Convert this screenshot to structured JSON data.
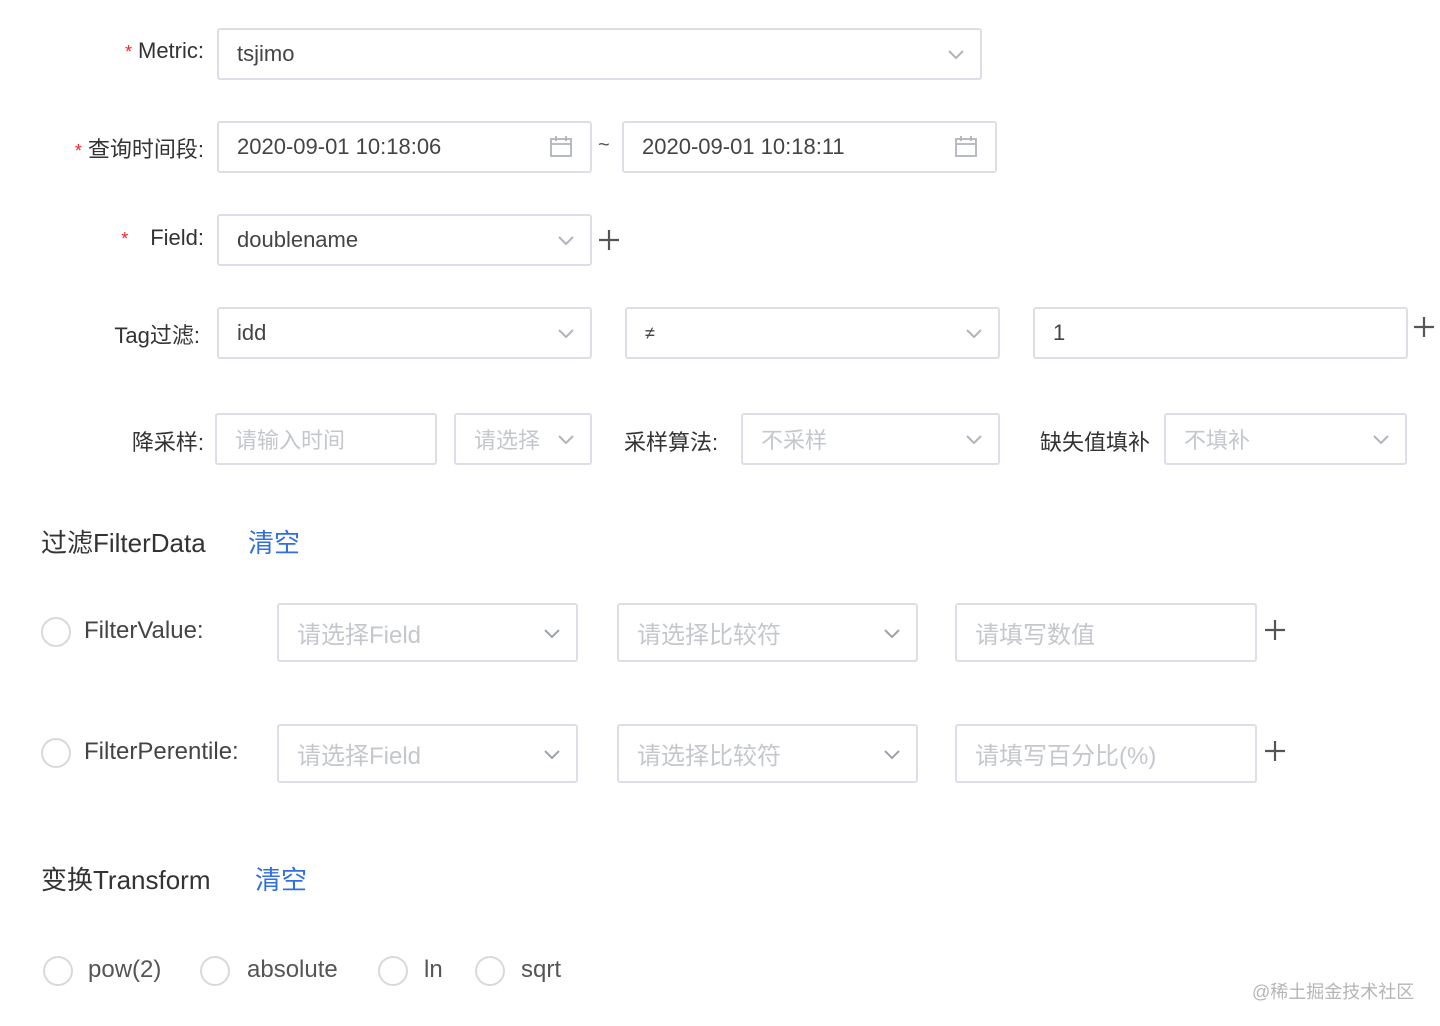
{
  "form": {
    "metric": {
      "required": "*",
      "label": "Metric:",
      "value": "tsjimo"
    },
    "time_range": {
      "required": "*",
      "label": "查询时间段:",
      "start": "2020-09-01 10:18:06",
      "separator": "~",
      "end": "2020-09-01 10:18:11"
    },
    "field": {
      "required": "*",
      "label": "Field:",
      "value": "doublename"
    },
    "tag_filter": {
      "label": "Tag过滤:",
      "tag": "idd",
      "operator": "≠",
      "value": "1"
    },
    "downsample": {
      "label": "降采样:",
      "time_placeholder": "请输入时间",
      "unit_placeholder": "请选择",
      "algo_label": "采样算法:",
      "algo_placeholder": "不采样",
      "fill_label": "缺失值填补",
      "fill_placeholder": "不填补"
    }
  },
  "filter_section": {
    "title": "过滤FilterData",
    "clear": "清空",
    "rows": [
      {
        "label": "FilterValue:",
        "field_placeholder": "请选择Field",
        "op_placeholder": "请选择比较符",
        "value_placeholder": "请填写数值"
      },
      {
        "label": "FilterPerentile:",
        "field_placeholder": "请选择Field",
        "op_placeholder": "请选择比较符",
        "value_placeholder": "请填写百分比(%)"
      }
    ]
  },
  "transform_section": {
    "title": "变换Transform",
    "clear": "清空",
    "options": [
      "pow(2)",
      "absolute",
      "ln",
      "sqrt"
    ]
  },
  "watermark": "@稀土掘金技术社区",
  "icons": {
    "dropdown": "chevron-down-icon",
    "date": "calendar-icon",
    "add": "plus-icon"
  },
  "colors": {
    "required": "#f5222d",
    "link": "#2f6fde",
    "border": "#dcdfe6",
    "placeholder": "#c4c7cc"
  }
}
